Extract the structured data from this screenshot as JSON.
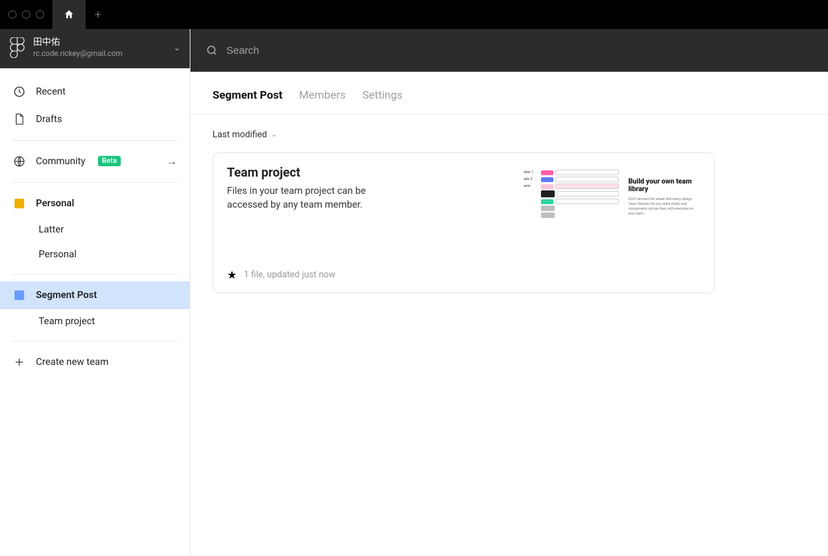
{
  "topbar": {
    "plus_label": "+"
  },
  "user": {
    "display_name": "田中佑",
    "email": "rc.code.rickey@gmail.com"
  },
  "search": {
    "placeholder": "Search"
  },
  "nav": {
    "recent": "Recent",
    "drafts": "Drafts",
    "community": "Community",
    "community_badge": "Beta",
    "create_team": "Create new team"
  },
  "teams": [
    {
      "name": "Personal",
      "color": "#f1b000",
      "active": false,
      "projects": [
        {
          "name": "Latter"
        },
        {
          "name": "Personal"
        }
      ]
    },
    {
      "name": "Segment Post",
      "color": "#6a9cff",
      "active": true,
      "projects": [
        {
          "name": "Team project"
        }
      ]
    }
  ],
  "main": {
    "tabs": [
      {
        "label": "Segment Post",
        "active": true
      },
      {
        "label": "Members",
        "active": false
      },
      {
        "label": "Settings",
        "active": false
      }
    ],
    "sort_label": "Last modified"
  },
  "project_card": {
    "title": "Team project",
    "description": "Files in your team project can be accessed by any team member.",
    "footer": "1 file, updated just now",
    "thumbnail": {
      "right_title": "Build your own team library",
      "right_body": "Don't reinvent the wheel with every design. Team libraries let you share styles and components across files, with everyone on your team.",
      "left_labels": [
        "ader 1",
        "ade 3",
        "auto",
        "",
        "",
        "",
        ""
      ]
    }
  }
}
